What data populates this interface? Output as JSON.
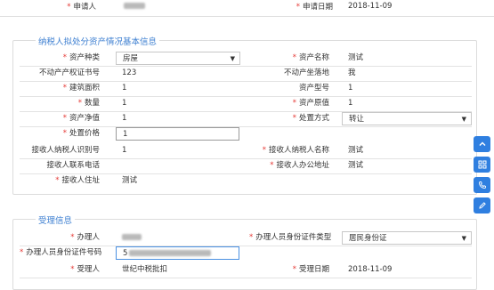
{
  "top": {
    "applicant_label": "申请人",
    "apply_date_label": "申请日期",
    "apply_date_value": "2018-11-09"
  },
  "asset_section": {
    "title": "纳税人拟处分资产情况基本信息",
    "asset_type_label": "资产种类",
    "asset_type_value": "房屋",
    "asset_name_label": "资产名称",
    "asset_name_value": "测试",
    "property_cert_label": "不动产产权证书号",
    "property_cert_value": "123",
    "property_location_label": "不动产坐落地",
    "property_location_value": "我",
    "building_area_label": "建筑面积",
    "building_area_value": "1",
    "asset_model_label": "资产型号",
    "asset_model_value": "1",
    "quantity_label": "数量",
    "quantity_value": "1",
    "asset_original_label": "资产原值",
    "asset_original_value": "1",
    "asset_net_label": "资产净值",
    "asset_net_value": "1",
    "disposal_method_label": "处置方式",
    "disposal_method_value": "转让",
    "disposal_price_label": "处置价格",
    "disposal_price_value": "1",
    "receiver_taxid_label": "接收人纳税人识别号",
    "receiver_taxid_value": "1",
    "receiver_taxname_label": "接收人纳税人名称",
    "receiver_taxname_value": "测试",
    "receiver_phone_label": "接收人联系电话",
    "receiver_phone_value": "",
    "receiver_office_label": "接收人办公地址",
    "receiver_office_value": "测试",
    "receiver_address_label": "接收人住址",
    "receiver_address_value": "测试"
  },
  "accept_section": {
    "title": "受理信息",
    "handler_label": "办理人",
    "handler_id_type_label": "办理人员身份证件类型",
    "handler_id_type_value": "居民身份证",
    "handler_id_no_label": "办理人员身份证件号码",
    "handler_id_no_prefix": "5",
    "acceptor_label": "受理人",
    "acceptor_value": "世纪中税批扣",
    "accept_date_label": "受理日期",
    "accept_date_value": "2018-11-09"
  },
  "side_toolbar": [
    "arrow-up-icon",
    "grid-icon",
    "phone-icon",
    "edit-icon"
  ],
  "colors": {
    "accent": "#2f7fe0",
    "required": "#e53935",
    "legend": "#3d7fd1"
  }
}
